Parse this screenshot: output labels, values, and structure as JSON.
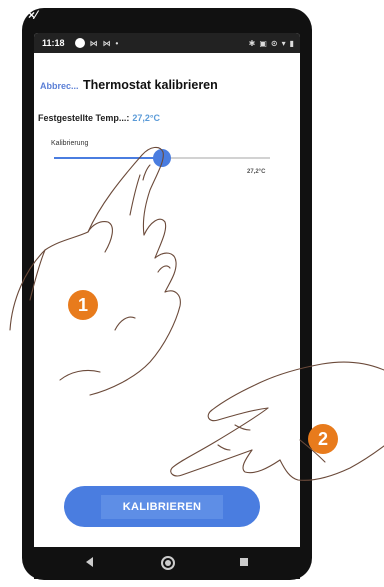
{
  "status_bar": {
    "time": "11:18"
  },
  "header": {
    "back_label": "Abbrec...",
    "title": "Thermostat kalibrieren"
  },
  "measured": {
    "label": "Festgestellte Temp...:",
    "value": "27,2°C"
  },
  "calibration": {
    "label": "Kalibrierung",
    "value": "27,2°C",
    "level": 0.5
  },
  "button": {
    "label": "KALIBRIEREN"
  },
  "steps": [
    "1",
    "2"
  ],
  "colors": {
    "accent": "#4a7de0",
    "temp_value": "#5b9bd8",
    "step_badge": "#e87b1c"
  },
  "icons": [
    "close-tilde-icon",
    "record-icon",
    "message-icon",
    "bluetooth-icon",
    "signal-icon",
    "wifi-icon",
    "battery-icon",
    "nav-back-icon",
    "nav-home-icon",
    "nav-recent-icon"
  ]
}
